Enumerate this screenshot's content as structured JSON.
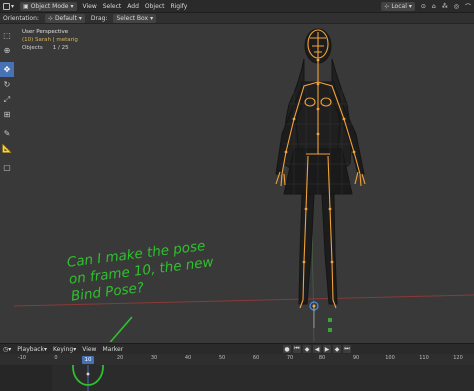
{
  "header": {
    "mode_label": "Object Mode",
    "menus": [
      "View",
      "Select",
      "Add",
      "Object",
      "Rigify"
    ],
    "orientation_space": "Local"
  },
  "tool_settings": {
    "orientation_label": "Orientation:",
    "orientation_value": "Default",
    "drag_label": "Drag:",
    "drag_value": "Select Box"
  },
  "viewport_info": {
    "perspective": "User Perspective",
    "collection": "(10) Sarah | metarig",
    "objects_label": "Objects",
    "objects_value": "1 / 25"
  },
  "annotation": {
    "text": "Can I make the pose\non frame 10, the new\nBind Pose?"
  },
  "timeline": {
    "menus": [
      "Playback",
      "Keying",
      "View",
      "Marker"
    ],
    "current_frame": "10",
    "ticks": [
      "-10",
      "0",
      "10",
      "20",
      "40",
      "60",
      "80",
      "100",
      "120"
    ]
  },
  "colors": {
    "accent": "#4772b3",
    "armature": "#f2a23a",
    "annotation": "#2ec02e"
  }
}
